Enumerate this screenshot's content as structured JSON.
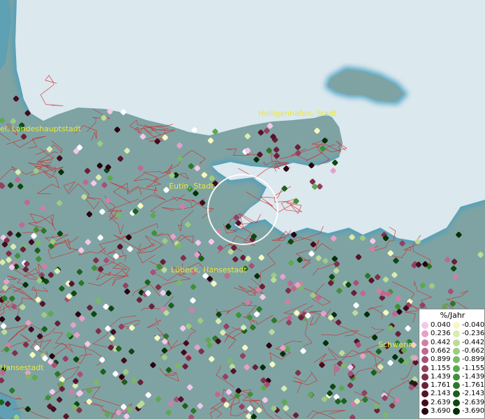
{
  "map": {
    "labels": [
      {
        "id": "kiel",
        "text": "el, Landeshauptstadt"
      },
      {
        "id": "heiligenhafen",
        "text": "Heiligenhafen, Stadt"
      },
      {
        "id": "eutin",
        "text": "Eutin, Stadt"
      },
      {
        "id": "luebeck",
        "text": "Lübeck, Hansestadt"
      },
      {
        "id": "wismar",
        "text": "Hansestadt"
      },
      {
        "id": "schwerin",
        "text": "Schwerin, L"
      }
    ],
    "colors": {
      "sea": "#dbe8ee",
      "land": "#7fa3a3",
      "coast_glow": "#4aa0c0",
      "borders": "#d02a2a",
      "label": "#e8e83a",
      "highlight_ring": "#ffffff"
    }
  },
  "legend": {
    "title": "%/Jahr",
    "positive": [
      {
        "value": "0.040",
        "color": "#f4c8ea"
      },
      {
        "value": "0.236",
        "color": "#e8a0c8"
      },
      {
        "value": "0.442",
        "color": "#d080a8"
      },
      {
        "value": "0.662",
        "color": "#c06890"
      },
      {
        "value": "0.899",
        "color": "#a85078"
      },
      {
        "value": "1.155",
        "color": "#944060"
      },
      {
        "value": "1.439",
        "color": "#803048"
      },
      {
        "value": "1.761",
        "color": "#6a2038"
      },
      {
        "value": "2.143",
        "color": "#561428"
      },
      {
        "value": "2.639",
        "color": "#420c1c"
      },
      {
        "value": "3.690",
        "color": "#2a0410"
      }
    ],
    "negative": [
      {
        "value": "-0.040",
        "color": "#f6f8c0"
      },
      {
        "value": "-0.236",
        "color": "#d8ecb0"
      },
      {
        "value": "-0.442",
        "color": "#bcdc98"
      },
      {
        "value": "-0.662",
        "color": "#9ccc80"
      },
      {
        "value": "-0.899",
        "color": "#7cb868"
      },
      {
        "value": "-1.155",
        "color": "#5ea850"
      },
      {
        "value": "-1.439",
        "color": "#409038"
      },
      {
        "value": "-1.761",
        "color": "#2c7828"
      },
      {
        "value": "-2.143",
        "color": "#1c601c"
      },
      {
        "value": "-2.639",
        "color": "#0e4810"
      },
      {
        "value": "-3.690",
        "color": "#043008"
      }
    ]
  }
}
